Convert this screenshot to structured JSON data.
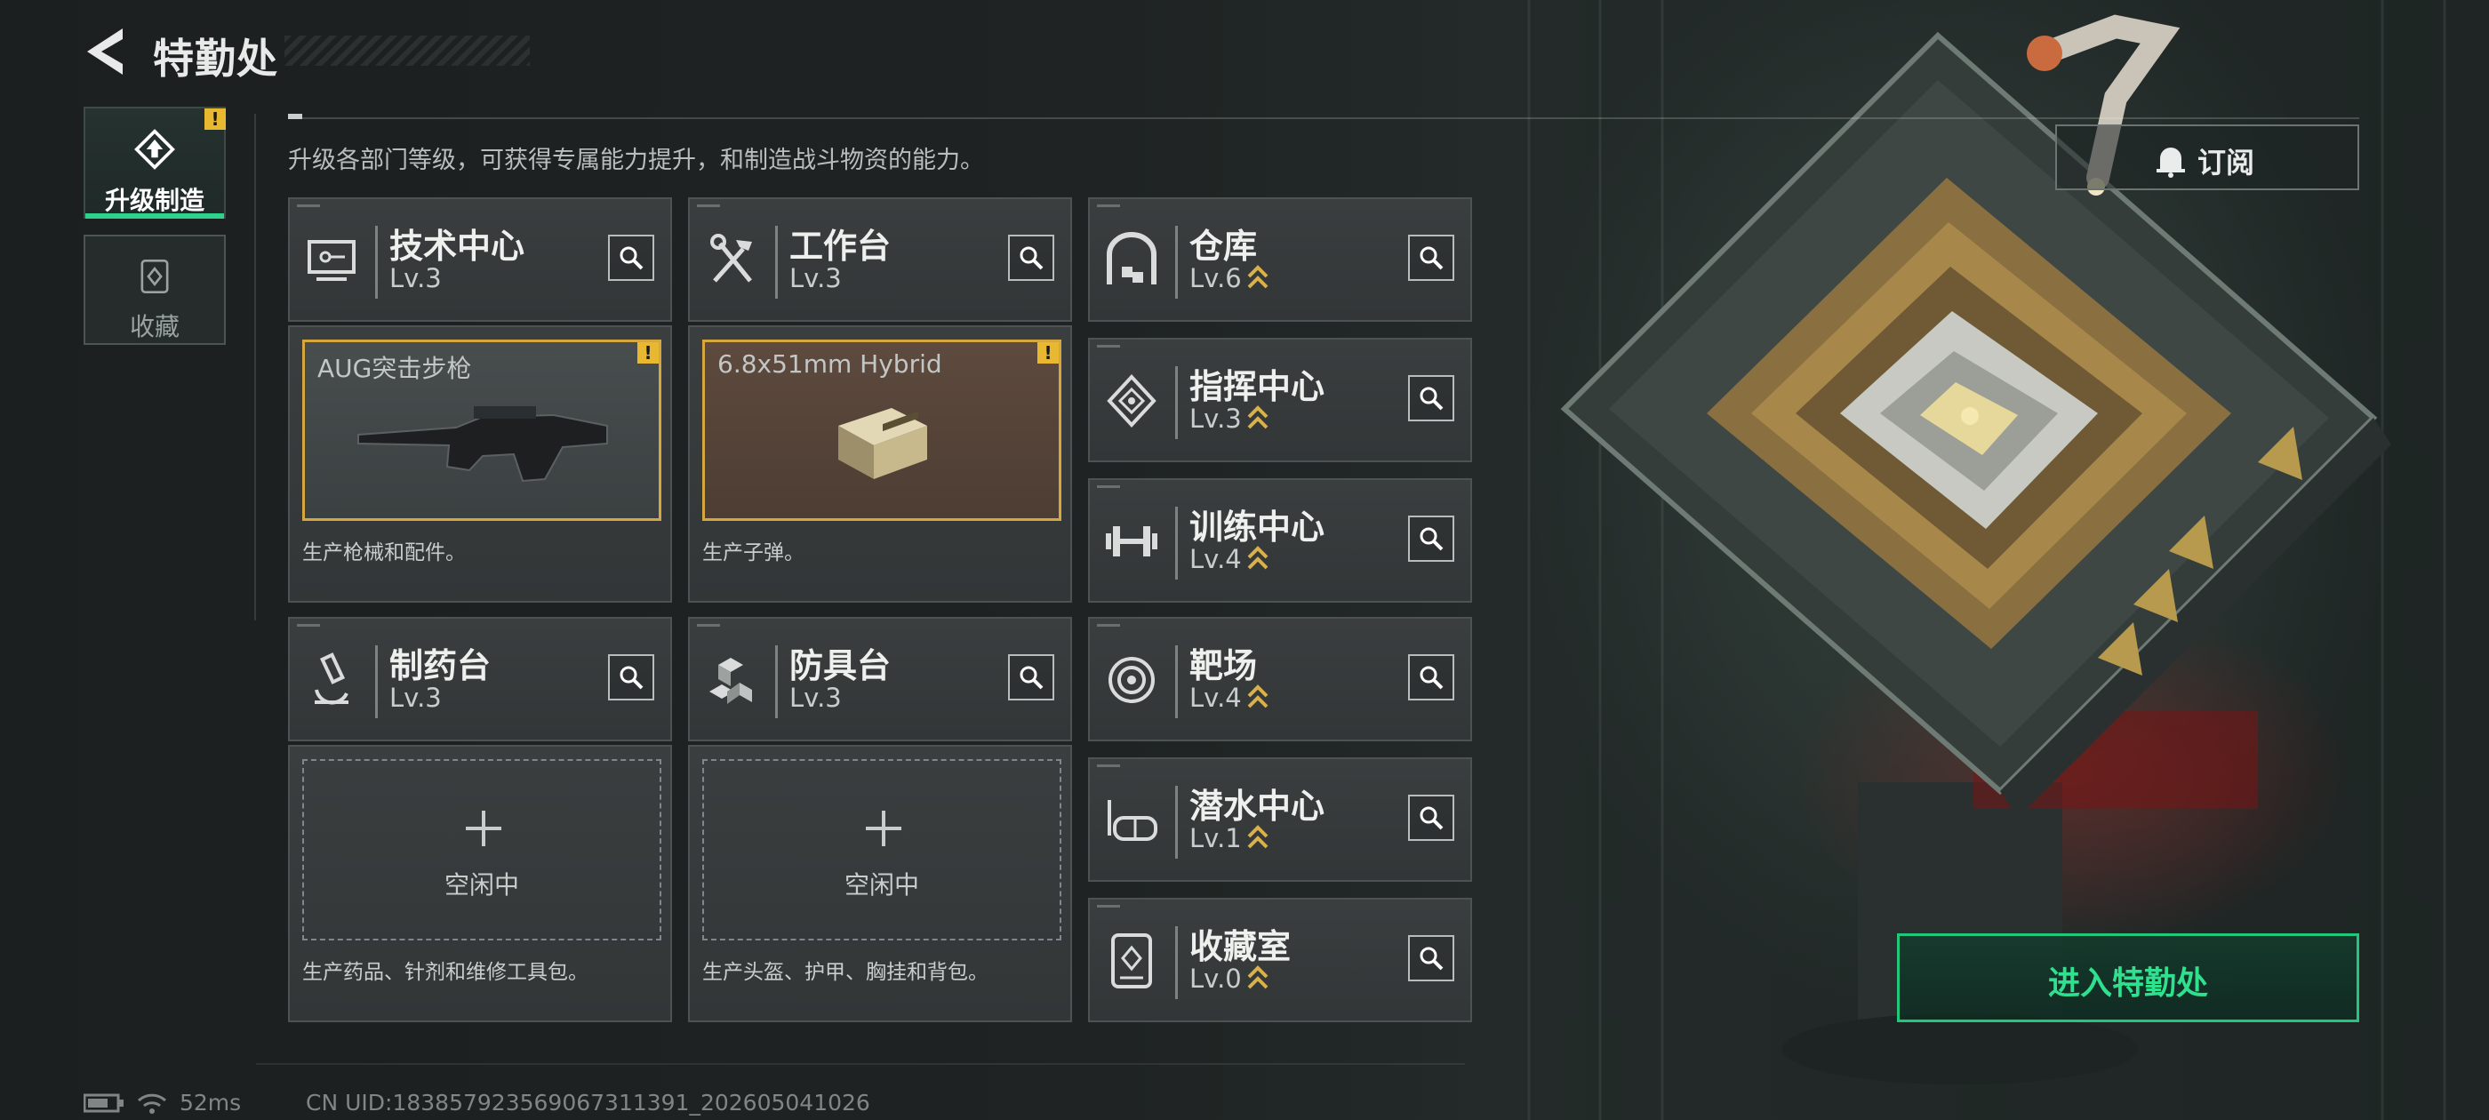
{
  "header": {
    "title": "特勤处",
    "back_icon": "back-arrow-icon"
  },
  "nav": {
    "tabs": [
      {
        "label": "升级制造",
        "icon": "upgrade-icon",
        "active": true,
        "alert": "!"
      },
      {
        "label": "收藏",
        "icon": "collection-icon",
        "active": false
      }
    ]
  },
  "intro": "升级各部门等级，可获得专属能力提升，和制造战斗物资的能力。",
  "departments": {
    "tech": {
      "name": "技术中心",
      "level": "Lv.3",
      "icon": "computer-icon"
    },
    "bench": {
      "name": "工作台",
      "level": "Lv.3",
      "icon": "tools-icon"
    },
    "pharma": {
      "name": "制药台",
      "level": "Lv.3",
      "icon": "microscope-icon"
    },
    "armor": {
      "name": "防具台",
      "level": "Lv.3",
      "icon": "armor-blocks-icon"
    },
    "warehouse": {
      "name": "仓库",
      "level": "Lv.6",
      "icon": "warehouse-icon",
      "upgradable": true
    },
    "command": {
      "name": "指挥中心",
      "level": "Lv.3",
      "icon": "command-icon",
      "upgradable": true
    },
    "training": {
      "name": "训练中心",
      "level": "Lv.4",
      "icon": "dumbbell-icon",
      "upgradable": true
    },
    "range": {
      "name": "靶场",
      "level": "Lv.4",
      "icon": "target-icon",
      "upgradable": true
    },
    "diving": {
      "name": "潜水中心",
      "level": "Lv.1",
      "icon": "diving-mask-icon",
      "upgradable": true
    },
    "vault": {
      "name": "收藏室",
      "level": "Lv.0",
      "icon": "vault-icon",
      "upgradable": true
    }
  },
  "production": {
    "tech": {
      "item": "AUG突击步枪",
      "desc": "生产枪械和配件。",
      "alert": "!"
    },
    "bench": {
      "item": "6.8x51mm Hybrid",
      "desc": "生产子弹。",
      "alert": "!"
    },
    "pharma": {
      "idle": "空闲中",
      "desc": "生产药品、针剂和维修工具包。"
    },
    "armor": {
      "idle": "空闲中",
      "desc": "生产头盔、护甲、胸挂和背包。"
    }
  },
  "subscribe": {
    "label": "订阅",
    "icon": "bell-icon"
  },
  "enter": {
    "label": "进入特勤处"
  },
  "status": {
    "ping": "52ms",
    "uid": "CN UID:18385792356906731139​1_202605041026"
  },
  "colors": {
    "accent_green": "#2fd28a",
    "alert_yellow": "#e8b830",
    "slot_gold": "#d5a73e"
  }
}
